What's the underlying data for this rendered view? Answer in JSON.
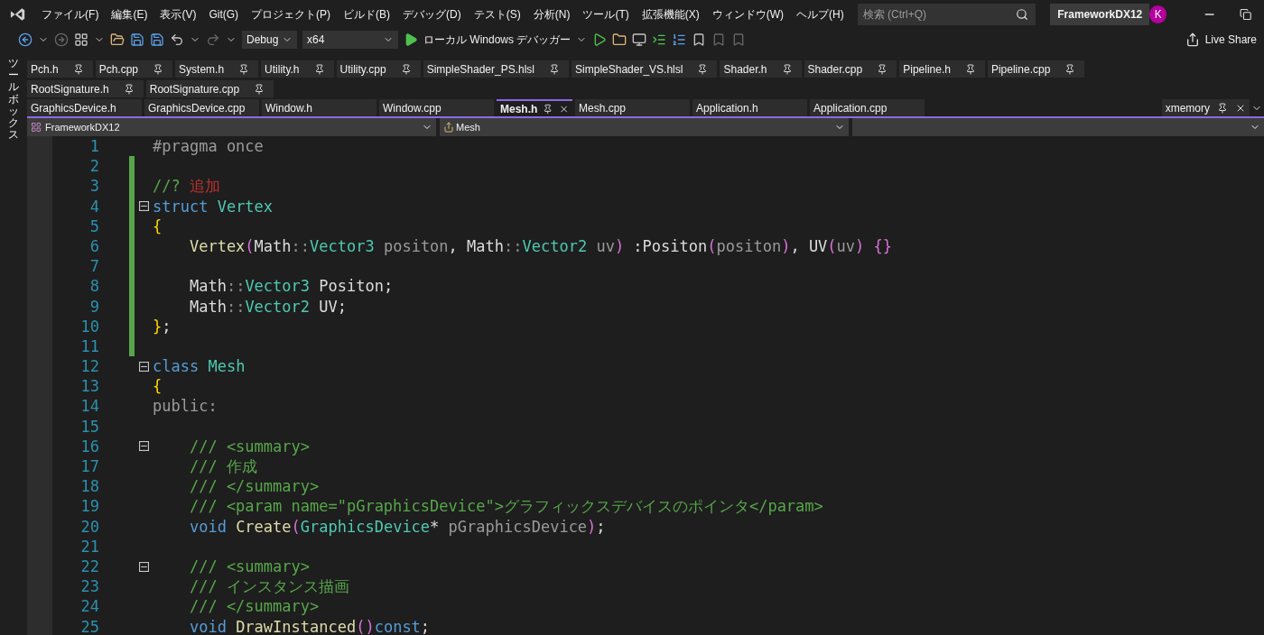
{
  "menu": [
    "ファイル(F)",
    "編集(E)",
    "表示(V)",
    "Git(G)",
    "プロジェクト(P)",
    "ビルド(B)",
    "デバッグ(D)",
    "テスト(S)",
    "分析(N)",
    "ツール(T)",
    "拡張機能(X)",
    "ウィンドウ(W)",
    "ヘルプ(H)"
  ],
  "search": {
    "placeholder": "検索 (Ctrl+Q)"
  },
  "solution_name": "FrameworkDX12",
  "user_initial": "K",
  "toolbar": {
    "configuration": "Debug",
    "platform": "x64",
    "debug_target": "ローカル Windows デバッガー"
  },
  "live_share": "Live Share",
  "toolbox_label": "ツールボックス",
  "pinned_tabs": [
    {
      "label": "Pch.h"
    },
    {
      "label": "Pch.cpp"
    },
    {
      "label": "System.h"
    },
    {
      "label": "Utility.h"
    },
    {
      "label": "Utility.cpp"
    },
    {
      "label": "SimpleShader_PS.hlsl"
    },
    {
      "label": "SimpleShader_VS.hlsl"
    },
    {
      "label": "Shader.h"
    },
    {
      "label": "Shader.cpp"
    },
    {
      "label": "Pipeline.h"
    },
    {
      "label": "Pipeline.cpp"
    },
    {
      "label": "RootSignature.h"
    },
    {
      "label": "RootSignature.cpp"
    }
  ],
  "tabs": [
    {
      "label": "GraphicsDevice.h",
      "selected": false
    },
    {
      "label": "GraphicsDevice.cpp",
      "selected": false
    },
    {
      "label": "Window.h",
      "selected": false
    },
    {
      "label": "Window.cpp",
      "selected": false
    },
    {
      "label": "Mesh.h",
      "selected": true
    },
    {
      "label": "Mesh.cpp",
      "selected": false
    },
    {
      "label": "Application.h",
      "selected": false
    },
    {
      "label": "Application.cpp",
      "selected": false
    }
  ],
  "preview_tab": {
    "label": "xmemory"
  },
  "nav_bar": {
    "project": "FrameworkDX12",
    "scope": "Mesh"
  },
  "code_lines": [
    {
      "number": "1",
      "changed": false,
      "fold": false,
      "tokens": [
        {
          "kind": "preproc",
          "text": "#pragma once"
        }
      ]
    },
    {
      "number": "2",
      "changed": true,
      "fold": false
    },
    {
      "number": "3",
      "changed": true,
      "fold": false,
      "tokens": [
        {
          "kind": "comment",
          "text": "//? "
        },
        {
          "kind": "string",
          "text": "追加"
        }
      ]
    },
    {
      "number": "4",
      "changed": true,
      "fold": true,
      "tokens": [
        {
          "kind": "keyword",
          "text": "struct "
        },
        {
          "kind": "type",
          "text": "Vertex"
        }
      ]
    },
    {
      "number": "5",
      "changed": true,
      "fold": false,
      "tokens": [
        {
          "kind": "brace",
          "text": "{"
        }
      ]
    },
    {
      "number": "6",
      "changed": true,
      "fold": false,
      "tokens": [
        {
          "kind": "func",
          "text": "    Vertex"
        },
        {
          "kind": "paren",
          "text": "("
        },
        {
          "kind": "plain",
          "text": "Math"
        },
        {
          "kind": "op",
          "text": "::"
        },
        {
          "kind": "type",
          "text": "Vector3"
        },
        {
          "kind": "param",
          "text": " positon"
        },
        {
          "kind": "plain",
          "text": ", Math"
        },
        {
          "kind": "op",
          "text": "::"
        },
        {
          "kind": "type",
          "text": "Vector2"
        },
        {
          "kind": "param",
          "text": " uv"
        },
        {
          "kind": "paren",
          "text": ")"
        },
        {
          "kind": "plain",
          "text": " :Positon"
        },
        {
          "kind": "paren",
          "text": "("
        },
        {
          "kind": "param",
          "text": "positon"
        },
        {
          "kind": "paren",
          "text": ")"
        },
        {
          "kind": "plain",
          "text": ", UV"
        },
        {
          "kind": "paren",
          "text": "("
        },
        {
          "kind": "param",
          "text": "uv"
        },
        {
          "kind": "paren",
          "text": ")"
        },
        {
          "kind": "paren",
          "text": " {}"
        }
      ]
    },
    {
      "number": "7",
      "changed": true,
      "fold": false
    },
    {
      "number": "8",
      "changed": true,
      "fold": false,
      "tokens": [
        {
          "kind": "plain",
          "text": "    Math"
        },
        {
          "kind": "op",
          "text": "::"
        },
        {
          "kind": "type",
          "text": "Vector3"
        },
        {
          "kind": "plain",
          "text": " Positon;"
        }
      ]
    },
    {
      "number": "9",
      "changed": true,
      "fold": false,
      "tokens": [
        {
          "kind": "plain",
          "text": "    Math"
        },
        {
          "kind": "op",
          "text": "::"
        },
        {
          "kind": "type",
          "text": "Vector2"
        },
        {
          "kind": "plain",
          "text": " UV;"
        }
      ]
    },
    {
      "number": "10",
      "changed": true,
      "fold": false,
      "tokens": [
        {
          "kind": "brace",
          "text": "}"
        },
        {
          "kind": "plain",
          "text": ";"
        }
      ]
    },
    {
      "number": "11",
      "changed": true,
      "fold": false
    },
    {
      "number": "12",
      "changed": false,
      "fold": true,
      "tokens": [
        {
          "kind": "keyword",
          "text": "class "
        },
        {
          "kind": "type",
          "text": "Mesh"
        }
      ]
    },
    {
      "number": "13",
      "changed": false,
      "fold": false,
      "tokens": [
        {
          "kind": "brace",
          "text": "{"
        }
      ]
    },
    {
      "number": "14",
      "changed": false,
      "fold": false,
      "tokens": [
        {
          "kind": "preproc",
          "text": "public:"
        }
      ]
    },
    {
      "number": "15",
      "changed": false,
      "fold": false
    },
    {
      "number": "16",
      "changed": false,
      "fold": true,
      "tokens": [
        {
          "kind": "comment",
          "text": "    /// <summary>"
        }
      ]
    },
    {
      "number": "17",
      "changed": false,
      "fold": false,
      "tokens": [
        {
          "kind": "comment",
          "text": "    /// 作成"
        }
      ]
    },
    {
      "number": "18",
      "changed": false,
      "fold": false,
      "tokens": [
        {
          "kind": "comment",
          "text": "    /// </summary>"
        }
      ]
    },
    {
      "number": "19",
      "changed": false,
      "fold": false,
      "tokens": [
        {
          "kind": "comment",
          "text": "    /// <param name=\"pGraphicsDevice\">グラフィックスデバイスのポインタ</param>"
        }
      ]
    },
    {
      "number": "20",
      "changed": false,
      "fold": false,
      "tokens": [
        {
          "kind": "keyword",
          "text": "    void"
        },
        {
          "kind": "func",
          "text": " Create"
        },
        {
          "kind": "paren",
          "text": "("
        },
        {
          "kind": "type",
          "text": "GraphicsDevice"
        },
        {
          "kind": "plain",
          "text": "*"
        },
        {
          "kind": "param",
          "text": " pGraphicsDevice"
        },
        {
          "kind": "paren",
          "text": ")"
        },
        {
          "kind": "plain",
          "text": ";"
        }
      ]
    },
    {
      "number": "21",
      "changed": false,
      "fold": false
    },
    {
      "number": "22",
      "changed": false,
      "fold": true,
      "tokens": [
        {
          "kind": "comment",
          "text": "    /// <summary>"
        }
      ]
    },
    {
      "number": "23",
      "changed": false,
      "fold": false,
      "tokens": [
        {
          "kind": "comment",
          "text": "    /// インスタンス描画"
        }
      ]
    },
    {
      "number": "24",
      "changed": false,
      "fold": false,
      "tokens": [
        {
          "kind": "comment",
          "text": "    /// </summary>"
        }
      ]
    },
    {
      "number": "25",
      "changed": false,
      "fold": false,
      "tokens": [
        {
          "kind": "keyword",
          "text": "    void"
        },
        {
          "kind": "func",
          "text": " DrawInstanced"
        },
        {
          "kind": "paren",
          "text": "()"
        },
        {
          "kind": "keyword",
          "text": "const"
        },
        {
          "kind": "plain",
          "text": ";"
        }
      ]
    }
  ]
}
